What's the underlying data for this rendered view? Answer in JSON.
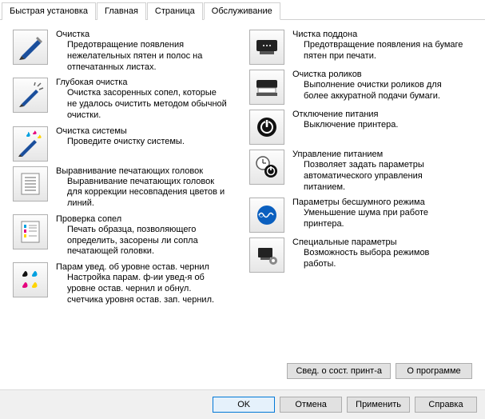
{
  "tabs": [
    "Быстрая установка",
    "Главная",
    "Страница",
    "Обслуживание"
  ],
  "active_tab": 3,
  "left_items": [
    {
      "title": "Очистка",
      "desc": "Предотвращение появления нежелательных пятен и полос на отпечатанных листах."
    },
    {
      "title": "Глубокая очистка",
      "desc": "Очистка засоренных сопел, которые не удалось очистить методом обычной очистки."
    },
    {
      "title": "Очистка системы",
      "desc": "Проведите очистку системы."
    },
    {
      "title": "Выравнивание печатающих головок",
      "desc": "Выравнивание печатающих головок для коррекции несовпадения цветов и линий."
    },
    {
      "title": "Проверка сопел",
      "desc": "Печать образца, позволяющего определить, засорены ли сопла печатающей головки."
    },
    {
      "title": "Парам увед. об уровне остав. чернил",
      "desc": "Настройка парам. ф-ии увед-я об уровне остав. чернил и обнул. счетчика уровня остав. зап. чернил."
    }
  ],
  "right_items": [
    {
      "title": "Чистка поддона",
      "desc": "Предотвращение появления на бумаге пятен при печати."
    },
    {
      "title": "Очистка роликов",
      "desc": "Выполнение очистки роликов для более аккуратной подачи бумаги."
    },
    {
      "title": "Отключение питания",
      "desc": "Выключение принтера."
    },
    {
      "title": "Управление питанием",
      "desc": "Позволяет задать параметры автоматического управления питанием."
    },
    {
      "title": "Параметры бесшумного режима",
      "desc": "Уменьшение шума при работе принтера."
    },
    {
      "title": "Специальные параметры",
      "desc": "Возможность выбора режимов работы."
    }
  ],
  "mid_buttons": {
    "status": "Свед. о сост. принт-а",
    "about": "О программе"
  },
  "footer": {
    "ok": "OK",
    "cancel": "Отмена",
    "apply": "Применить",
    "help": "Справка"
  }
}
